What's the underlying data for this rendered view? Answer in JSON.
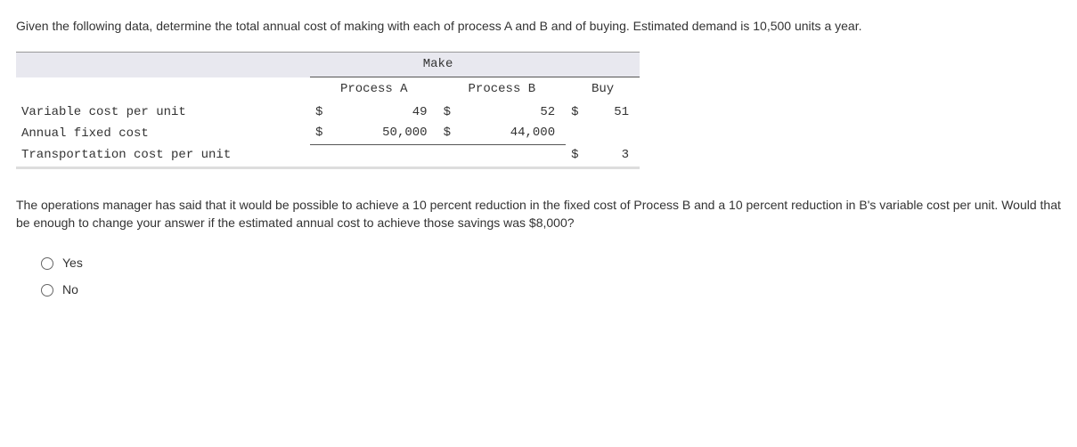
{
  "intro": "Given the following data, determine the total annual cost of making with each of process A and B and of buying. Estimated demand is 10,500 units a year.",
  "table": {
    "make_header": "Make",
    "columns": {
      "a": "Process A",
      "b": "Process B",
      "buy": "Buy"
    },
    "rows": {
      "var_cost": {
        "label": "Variable cost per unit",
        "a_sym": "$",
        "a_val": "49",
        "b_sym": "$",
        "b_val": "52",
        "buy_sym": "$",
        "buy_val": "51"
      },
      "fixed_cost": {
        "label": "Annual fixed cost",
        "a_sym": "$",
        "a_val": "50,000",
        "b_sym": "$",
        "b_val": "44,000",
        "buy_sym": "",
        "buy_val": ""
      },
      "transport": {
        "label": "Transportation cost per unit",
        "a_sym": "",
        "a_val": "",
        "b_sym": "",
        "b_val": "",
        "buy_sym": "$",
        "buy_val": "3"
      }
    }
  },
  "question2": "The operations manager has said that it would be possible to achieve a 10 percent reduction in the fixed cost of Process B and a 10 percent reduction in B's variable cost per unit. Would that be enough to change your answer if the estimated annual cost to achieve those savings was $8,000?",
  "options": {
    "yes": "Yes",
    "no": "No"
  }
}
